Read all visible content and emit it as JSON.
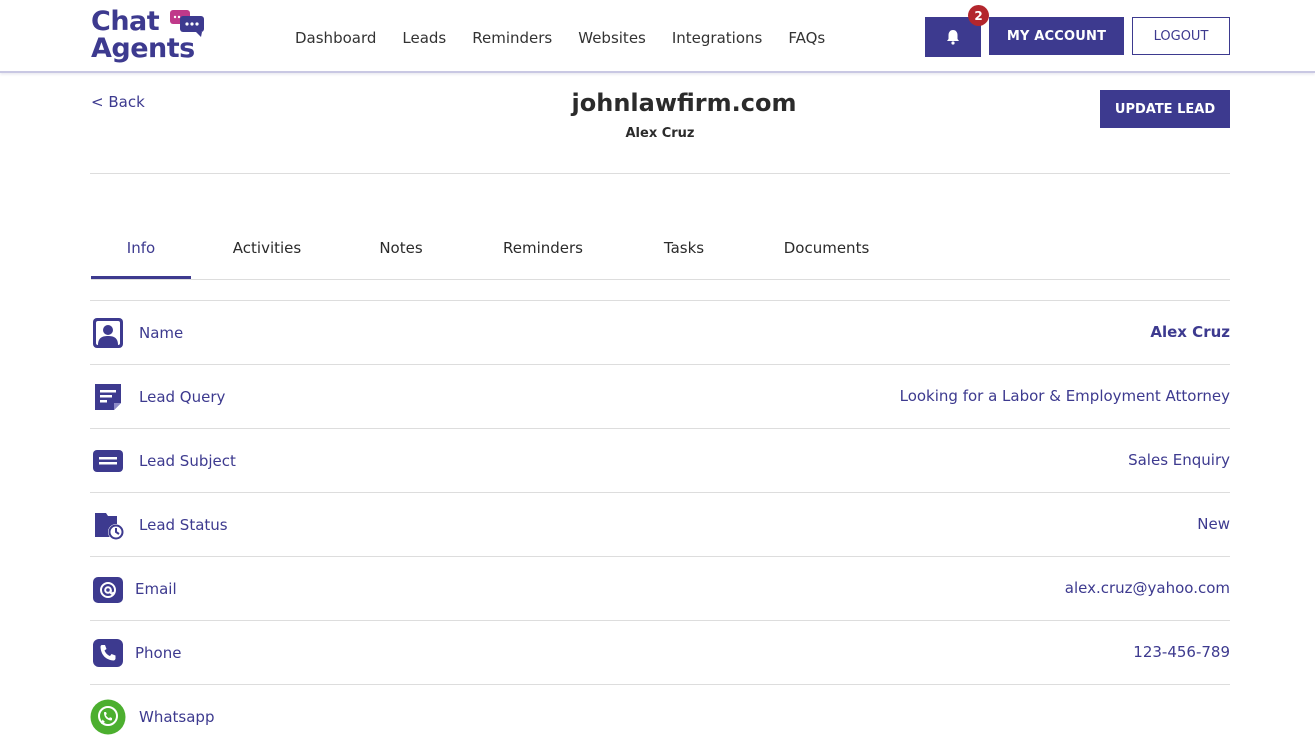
{
  "header": {
    "logo_line1": "Chat",
    "logo_line2": "Agents",
    "nav": [
      "Dashboard",
      "Leads",
      "Reminders",
      "Websites",
      "Integrations",
      "FAQs"
    ],
    "notification_count": "2",
    "my_account_label": "MY ACCOUNT",
    "logout_label": "LOGOUT",
    "brand_color": "#3d3a8f",
    "badge_color": "#b3262d"
  },
  "subheader": {
    "back_label": "< Back",
    "site_title": "johnlawfirm.com",
    "lead_name": "Alex Cruz",
    "update_label": "UPDATE LEAD"
  },
  "tabs": [
    "Info",
    "Activities",
    "Notes",
    "Reminders",
    "Tasks",
    "Documents"
  ],
  "active_tab": "Info",
  "info_rows": [
    {
      "icon": "user-icon",
      "label": "Name",
      "value": "Alex Cruz"
    },
    {
      "icon": "query-icon",
      "label": "Lead Query",
      "value": "Looking for a Labor & Employment Attorney"
    },
    {
      "icon": "subject-icon",
      "label": "Lead Subject",
      "value": "Sales Enquiry"
    },
    {
      "icon": "status-icon",
      "label": "Lead Status",
      "value": "New"
    },
    {
      "icon": "email-icon",
      "label": "Email",
      "value": "alex.cruz@yahoo.com"
    },
    {
      "icon": "phone-icon",
      "label": "Phone",
      "value": "123-456-789"
    },
    {
      "icon": "whatsapp-icon",
      "label": "Whatsapp",
      "value": ""
    }
  ]
}
